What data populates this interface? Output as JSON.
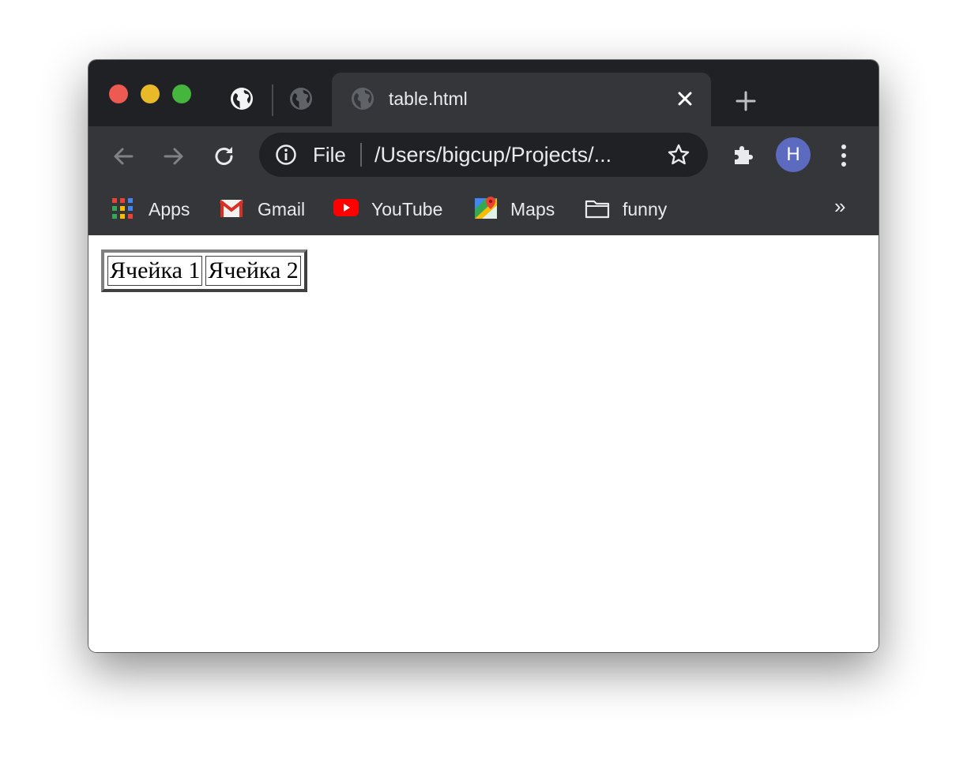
{
  "browser": {
    "active_tab_title": "table.html",
    "address": {
      "scheme_label": "File",
      "url": "/Users/bigcup/Projects/..."
    },
    "profile_initial": "H",
    "bookmarks": [
      {
        "label": "Apps",
        "icon": "apps-grid-icon"
      },
      {
        "label": "Gmail",
        "icon": "gmail-icon"
      },
      {
        "label": "YouTube",
        "icon": "youtube-icon"
      },
      {
        "label": "Maps",
        "icon": "maps-icon"
      },
      {
        "label": "funny",
        "icon": "folder-icon"
      }
    ],
    "bookmarks_overflow": "»",
    "colors": {
      "titlebar": "#202124",
      "toolbar": "#35363a",
      "omnibox": "#202124",
      "avatar": "#5c6bc0"
    }
  },
  "page": {
    "table": {
      "cells": [
        "Ячейка 1",
        "Ячейка 2"
      ]
    }
  }
}
